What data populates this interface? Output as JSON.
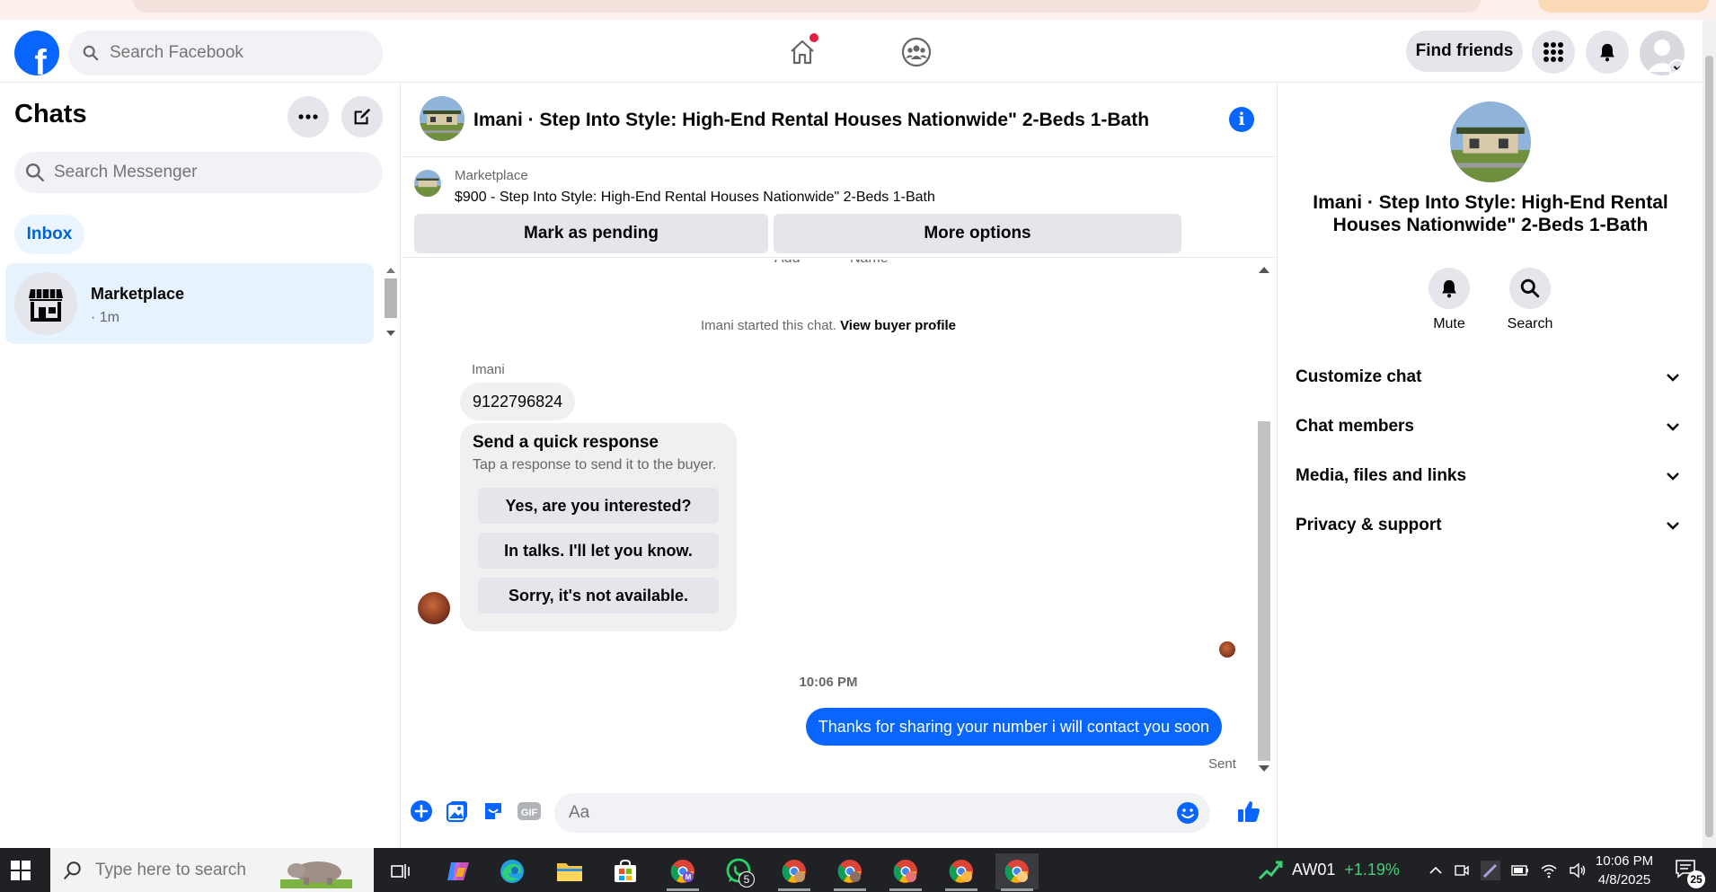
{
  "topbar": {
    "search_placeholder": "Search Facebook",
    "find_friends": "Find friends",
    "accent": "#0866ff"
  },
  "sidebar": {
    "title": "Chats",
    "search_placeholder": "Search Messenger",
    "filter": "Inbox",
    "chats": [
      {
        "name": "Marketplace",
        "time": "· 1m",
        "selected": true
      }
    ]
  },
  "conversation": {
    "title": "Imani · Step Into Style: High-End Rental Houses Nationwide\" 2-Beds 1-Bath",
    "marketplace": {
      "label": "Marketplace",
      "listing": "$900 - Step Into Style: High-End Rental Houses Nationwide\" 2-Beds 1-Bath",
      "mark_pending": "Mark as pending",
      "more_options": "More options"
    },
    "clipped_labels": [
      "Add",
      "Name"
    ],
    "started_text": "Imani started this chat.",
    "view_profile": "View buyer profile",
    "sender_name": "Imani",
    "incoming_message": "9122796824",
    "quick_response": {
      "title": "Send a quick response",
      "subtitle": "Tap a response to send it to the buyer.",
      "options": [
        "Yes, are you interested?",
        "In talks. I'll let you know.",
        "Sorry, it's not available."
      ]
    },
    "timestamp": "10:06 PM",
    "outgoing_message": "Thanks for sharing your number i will contact you soon",
    "status": "Sent",
    "composer_placeholder": "Aa"
  },
  "right_panel": {
    "title": "Imani · Step Into Style: High-End Rental Houses Nationwide\" 2-Beds 1-Bath",
    "actions": [
      "Mute",
      "Search"
    ],
    "sections": [
      "Customize chat",
      "Chat members",
      "Media, files and links",
      "Privacy & support"
    ]
  },
  "taskbar": {
    "search_placeholder": "Type here to search",
    "whatsapp_badge": "5",
    "stock_symbol": "AW01",
    "stock_change": "+1.19%",
    "time": "10:06 PM",
    "date": "4/8/2025",
    "notifications": "25"
  }
}
